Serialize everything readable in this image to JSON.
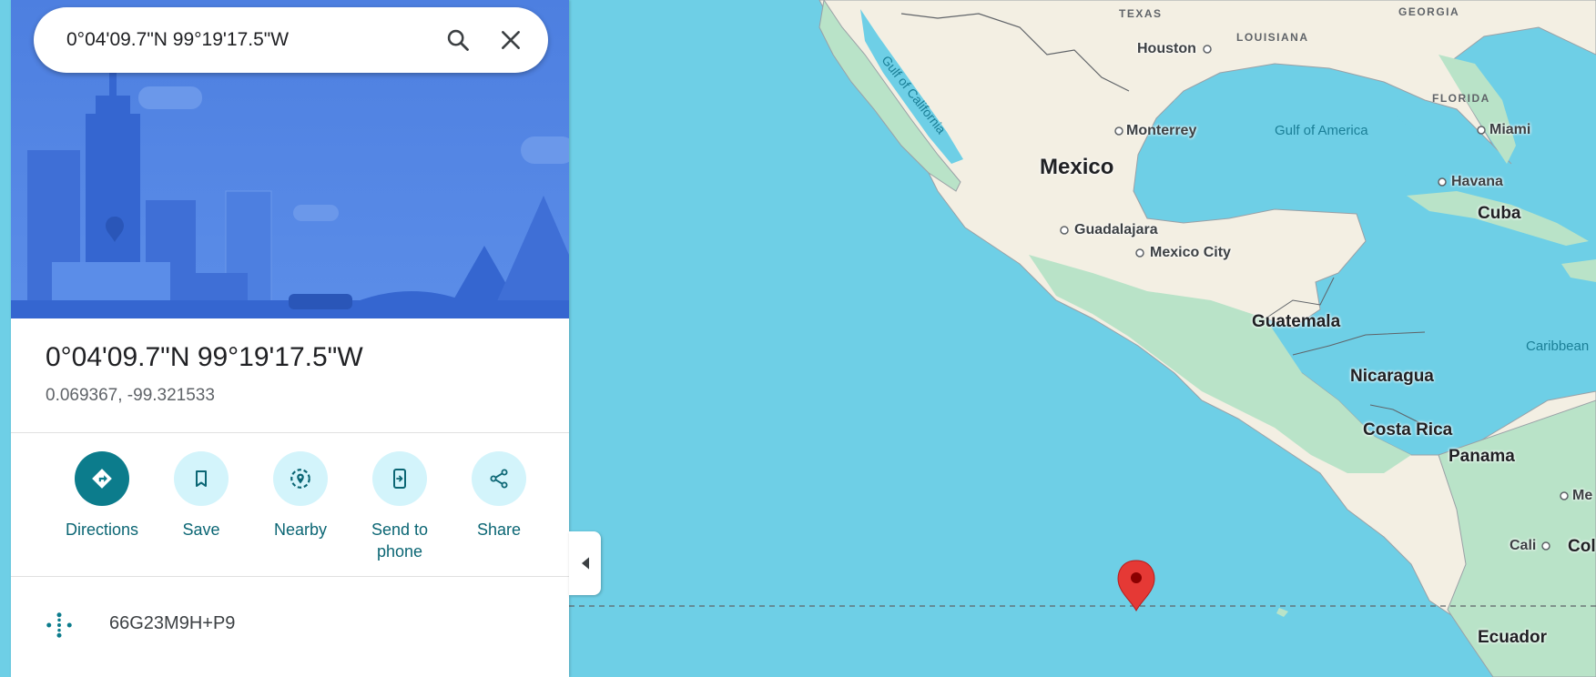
{
  "search": {
    "value": "0°04'09.7\"N 99°19'17.5\"W"
  },
  "place": {
    "title": "0°04'09.7\"N 99°19'17.5\"W",
    "coords": "0.069367, -99.321533"
  },
  "actions": [
    {
      "label": "Directions",
      "icon": "directions-icon"
    },
    {
      "label": "Save",
      "icon": "bookmark-icon"
    },
    {
      "label": "Nearby",
      "icon": "nearby-icon"
    },
    {
      "label": "Send to phone",
      "icon": "send-to-phone-icon"
    },
    {
      "label": "Share",
      "icon": "share-icon"
    }
  ],
  "plus_code": "66G23M9H+P9",
  "map": {
    "labels": {
      "texas": "TEXAS",
      "louisiana": "LOUISIANA",
      "georgia": "GEORGIA",
      "florida": "FLORIDA",
      "houston": "Houston",
      "monterrey": "Monterrey",
      "miami": "Miami",
      "havana": "Havana",
      "cuba": "Cuba",
      "mexico": "Mexico",
      "guadalajara": "Guadalajara",
      "mexico_city": "Mexico City",
      "guatemala": "Guatemala",
      "nicaragua": "Nicaragua",
      "costa_rica": "Costa Rica",
      "panama": "Panama",
      "ecuador": "Ecuador",
      "cali": "Cali",
      "col": "Col",
      "me": "Me",
      "gulf_of_california": "Gulf of California",
      "gulf_of_america": "Gulf of America",
      "caribbean": "Caribbean"
    }
  },
  "colors": {
    "water": "#6ecfe6",
    "land": "#f3efe3",
    "land_green": "#b9e3c8",
    "accent": "#0c7c8c",
    "pin": "#e53935"
  }
}
